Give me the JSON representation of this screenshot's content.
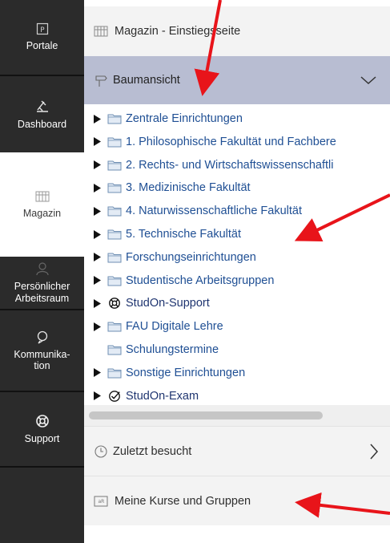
{
  "nav": {
    "items": [
      {
        "label": "Portale",
        "icon": "portal-icon",
        "active": false
      },
      {
        "label": "Dashboard",
        "icon": "dashboard-icon",
        "active": false
      },
      {
        "label": "Magazin",
        "icon": "magazine-icon",
        "active": true
      },
      {
        "label": "Persönlicher Arbeitsraum",
        "label_lines": [
          "Persönlicher",
          "Arbeitsraum"
        ],
        "icon": "person-icon",
        "active": false
      },
      {
        "label": "Kommunikation",
        "label_lines": [
          "Kommunika-",
          "tion"
        ],
        "icon": "communication-icon",
        "active": false
      },
      {
        "label": "Support",
        "icon": "lifebuoy-icon",
        "active": false
      }
    ],
    "colors": {
      "background": "#2b2b2b",
      "active_background": "#ffffff",
      "text": "#ffffff"
    }
  },
  "header": {
    "title": "Magazin - Einstiegsseite",
    "icon": "magazine-icon"
  },
  "tree_panel": {
    "title": "Baumansicht",
    "icon": "signpost-icon",
    "expanded": true,
    "header_color": "#b8bdd2",
    "items": [
      {
        "label": "Zentrale Einrichtungen",
        "icon": "folder-icon",
        "expandable": true
      },
      {
        "label": "1. Philosophische Fakultät und Fachbere",
        "icon": "folder-icon",
        "expandable": true
      },
      {
        "label": "2. Rechts- und Wirtschaftswissenschaftli",
        "icon": "folder-icon",
        "expandable": true
      },
      {
        "label": "3. Medizinische Fakultät",
        "icon": "folder-icon",
        "expandable": true
      },
      {
        "label": "4. Naturwissenschaftliche Fakultät",
        "icon": "folder-icon",
        "expandable": true
      },
      {
        "label": "5. Technische Fakultät",
        "icon": "folder-icon",
        "expandable": true
      },
      {
        "label": "Forschungseinrichtungen",
        "icon": "folder-icon",
        "expandable": true
      },
      {
        "label": "Studentische Arbeitsgruppen",
        "icon": "folder-icon",
        "expandable": true
      },
      {
        "label": "StudOn-Support",
        "icon": "lifebuoy-icon",
        "expandable": true
      },
      {
        "label": "FAU Digitale Lehre",
        "icon": "folder-icon",
        "expandable": true
      },
      {
        "label": "Schulungstermine",
        "icon": "folder-icon",
        "expandable": false
      },
      {
        "label": "Sonstige Einrichtungen",
        "icon": "folder-icon",
        "expandable": true
      },
      {
        "label": "StudOn-Exam",
        "icon": "check-circle-icon",
        "expandable": true
      }
    ],
    "link_color": "#1f4f94"
  },
  "recent_panel": {
    "title": "Zuletzt besucht",
    "icon": "clock-icon",
    "expanded": false
  },
  "courses_panel": {
    "title": "Meine Kurse und Gruppen",
    "icon": "courses-icon"
  },
  "annotation_color": "#e8141a"
}
